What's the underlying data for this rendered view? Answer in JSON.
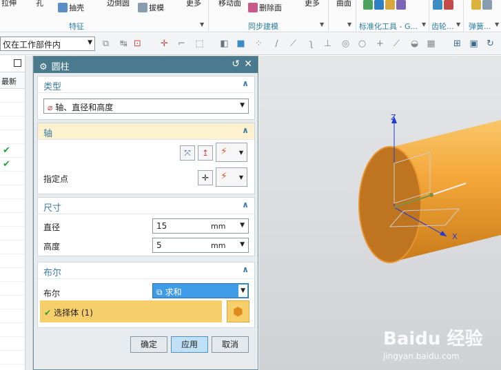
{
  "ribbon": {
    "items": [
      "拉伸",
      "孔",
      "抽壳",
      "边倒圆",
      "拔模",
      "更多",
      "移动面",
      "删除面",
      "更多",
      "曲面"
    ],
    "groups": [
      "特征",
      "同步建模",
      "标准化工具 - G...",
      "齿轮...",
      "弹簧..."
    ]
  },
  "toolbar": {
    "filter_value": "仅在工作部件内"
  },
  "left_nav": {
    "column_header": "最新",
    "rows": [
      "",
      "",
      "",
      "",
      "✔",
      "✔",
      "",
      "",
      "",
      "",
      "",
      "",
      "",
      "",
      "",
      "",
      "",
      "",
      "",
      ""
    ]
  },
  "dialog": {
    "title": "圆柱",
    "type_section": {
      "title": "类型",
      "value": "轴、直径和高度"
    },
    "axis_section": {
      "title": "轴",
      "point_label": "指定点"
    },
    "dimension_section": {
      "title": "尺寸",
      "diameter_label": "直径",
      "diameter_value": "15",
      "diameter_unit": "mm",
      "height_label": "高度",
      "height_value": "5",
      "height_unit": "mm"
    },
    "boolean_section": {
      "title": "布尔",
      "label": "布尔",
      "value": "求和",
      "select_body": "选择体 (1)"
    },
    "buttons": {
      "ok": "确定",
      "apply": "应用",
      "cancel": "取消"
    }
  },
  "viewport": {
    "axis_labels": {
      "z": "Z",
      "x": "X"
    },
    "cylinder_color": "#f5a83a"
  },
  "watermark": {
    "text": "Baidu 经验",
    "url": "jingyan.baidu.com"
  }
}
